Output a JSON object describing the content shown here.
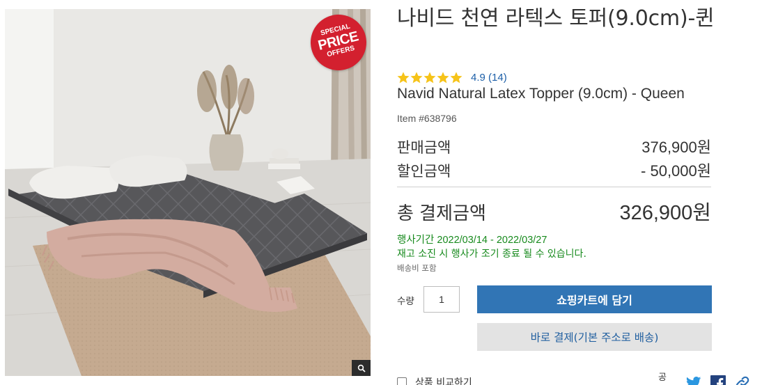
{
  "badge": {
    "line1": "SPECIAL",
    "line2": "PRICE",
    "line3": "OFFERS",
    "color": "#d3202f"
  },
  "product": {
    "title": "나비드 천연 라텍스 토퍼(9.0cm)-퀸",
    "rating": 4.9,
    "rating_text": "4.9 (14)",
    "stars": 5,
    "english_name": "Navid Natural Latex Topper (9.0cm) - Queen",
    "item_number": "Item #638796"
  },
  "pricing": {
    "sale_label": "판매금액",
    "sale_value": "376,900원",
    "discount_label": "할인금액",
    "discount_value": "- 50,000원",
    "total_label": "총 결제금액",
    "total_value": "326,900원"
  },
  "promo": {
    "period": "행사기간 2022/03/14 - 2022/03/27",
    "stock_note": "재고 소진 시 행사가 조기 종료 될 수 있습니다.",
    "shipping": "배송비 포함",
    "color": "#178a1d"
  },
  "purchase": {
    "qty_label": "수량",
    "qty_value": "1",
    "add_to_cart": "쇼핑카트에 담기",
    "buy_now": "바로 결제(기본 주소로 배송)",
    "cart_color": "#3175b5"
  },
  "footer": {
    "compare_label": "상품 비교하기",
    "share_label": "공유",
    "share_icons": [
      "twitter-icon",
      "facebook-icon",
      "link-icon"
    ]
  },
  "icons": {
    "zoom": "magnifier-icon",
    "star": "star-icon"
  }
}
